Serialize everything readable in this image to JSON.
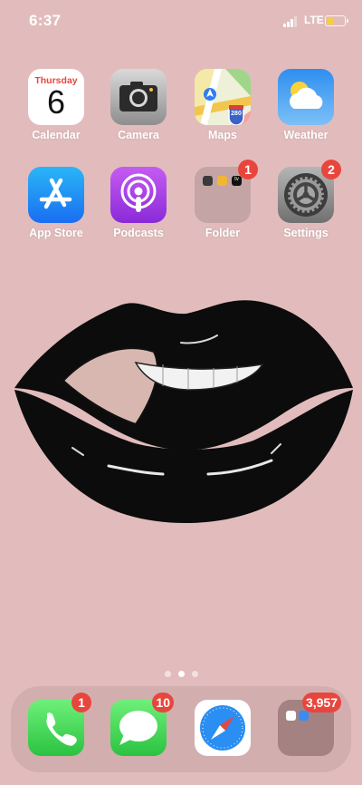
{
  "status_bar": {
    "time": "6:37",
    "network": "LTE",
    "battery_level": 0.4,
    "signal_bars": 3
  },
  "home_apps": [
    {
      "label": "Calendar",
      "icon": "calendar-icon",
      "calendar_day": "Thursday",
      "calendar_date": "6"
    },
    {
      "label": "Camera",
      "icon": "camera-icon"
    },
    {
      "label": "Maps",
      "icon": "maps-icon",
      "road_sign": "280"
    },
    {
      "label": "Weather",
      "icon": "weather-icon"
    },
    {
      "label": "App Store",
      "icon": "app-store-icon"
    },
    {
      "label": "Podcasts",
      "icon": "podcasts-icon"
    },
    {
      "label": "Folder",
      "icon": "folder-icon",
      "badge": "1",
      "folder_tv_label": "tv"
    },
    {
      "label": "Settings",
      "icon": "settings-icon",
      "badge": "2"
    }
  ],
  "page_indicator": {
    "pages": 3,
    "current": 2
  },
  "dock_apps": [
    {
      "name": "Phone",
      "icon": "phone-icon",
      "badge": "1"
    },
    {
      "name": "Messages",
      "icon": "messages-icon",
      "badge": "10"
    },
    {
      "name": "Safari",
      "icon": "safari-icon"
    },
    {
      "name": "Mail folder",
      "icon": "folder-icon",
      "badge": "3,957"
    }
  ],
  "colors": {
    "wallpaper": "#e2bcbc",
    "badge": "#e8463d",
    "battery": "#f7cf3b"
  }
}
